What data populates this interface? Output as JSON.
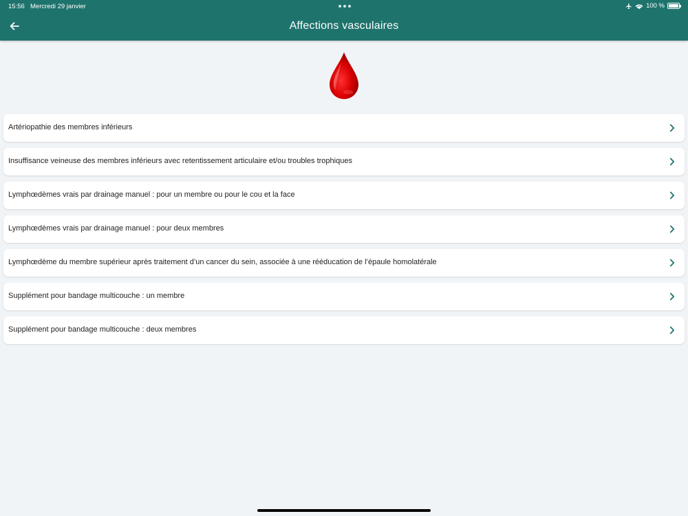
{
  "status_bar": {
    "time": "15:56",
    "date": "Mercredi 29 janvier",
    "battery": "100 %",
    "icons": [
      "airplane-icon",
      "wifi-icon",
      "battery-icon"
    ]
  },
  "header": {
    "title": "Affections vasculaires",
    "back_icon": "arrow-left-icon",
    "color": "#1e736d"
  },
  "hero": {
    "icon": "blood-drop-icon",
    "color": "#d90000"
  },
  "items": [
    {
      "label": "Artériopathie des membres inférieurs"
    },
    {
      "label": "Insuffisance veineuse des membres inférieurs avec retentissement articulaire et/ou troubles trophiques"
    },
    {
      "label": "Lymphœdèmes vrais par drainage manuel : pour un membre ou pour le cou et la face"
    },
    {
      "label": "Lymphœdèmes vrais par drainage manuel : pour deux membres"
    },
    {
      "label": "Lymphœdème du membre supérieur après traitement d’un cancer du sein, associée à une rééducation de l’épaule homolatérale"
    },
    {
      "label": "Supplément pour bandage multicouche : un membre"
    },
    {
      "label": "Supplément pour bandage multicouche : deux membres"
    }
  ],
  "accent_color": "#1e736d"
}
